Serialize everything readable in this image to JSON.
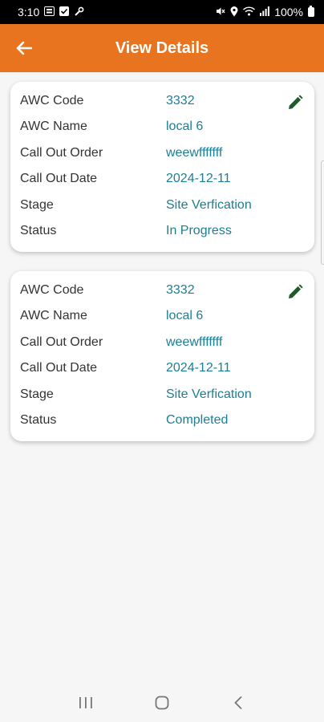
{
  "status_bar": {
    "time": "3:10",
    "battery": "100%",
    "icons_left": [
      "gallery-icon",
      "check-square-icon",
      "wrench-icon"
    ],
    "icons_right": [
      "mute-icon",
      "location-icon",
      "wifi-icon",
      "signal-icon",
      "battery-icon"
    ]
  },
  "app_bar": {
    "title": "View Details",
    "color": "#e8741f"
  },
  "cards": [
    {
      "rows": [
        {
          "label": "AWC Code",
          "value": "3332"
        },
        {
          "label": "AWC Name",
          "value": "local 6"
        },
        {
          "label": "Call Out Order",
          "value": "weewfffffff"
        },
        {
          "label": "Call Out Date",
          "value": "2024-12-11"
        },
        {
          "label": "Stage",
          "value": "Site Verfication"
        },
        {
          "label": "Status",
          "value": "In Progress"
        }
      ]
    },
    {
      "rows": [
        {
          "label": "AWC Code",
          "value": "3332"
        },
        {
          "label": "AWC Name",
          "value": "local 6"
        },
        {
          "label": "Call Out Order",
          "value": "weewfffffff"
        },
        {
          "label": "Call Out Date",
          "value": "2024-12-11"
        },
        {
          "label": "Stage",
          "value": "Site Verfication"
        },
        {
          "label": "Status",
          "value": "Completed"
        }
      ]
    }
  ],
  "colors": {
    "value_text": "#1a7f96",
    "edit_icon": "#1f5b2a"
  }
}
